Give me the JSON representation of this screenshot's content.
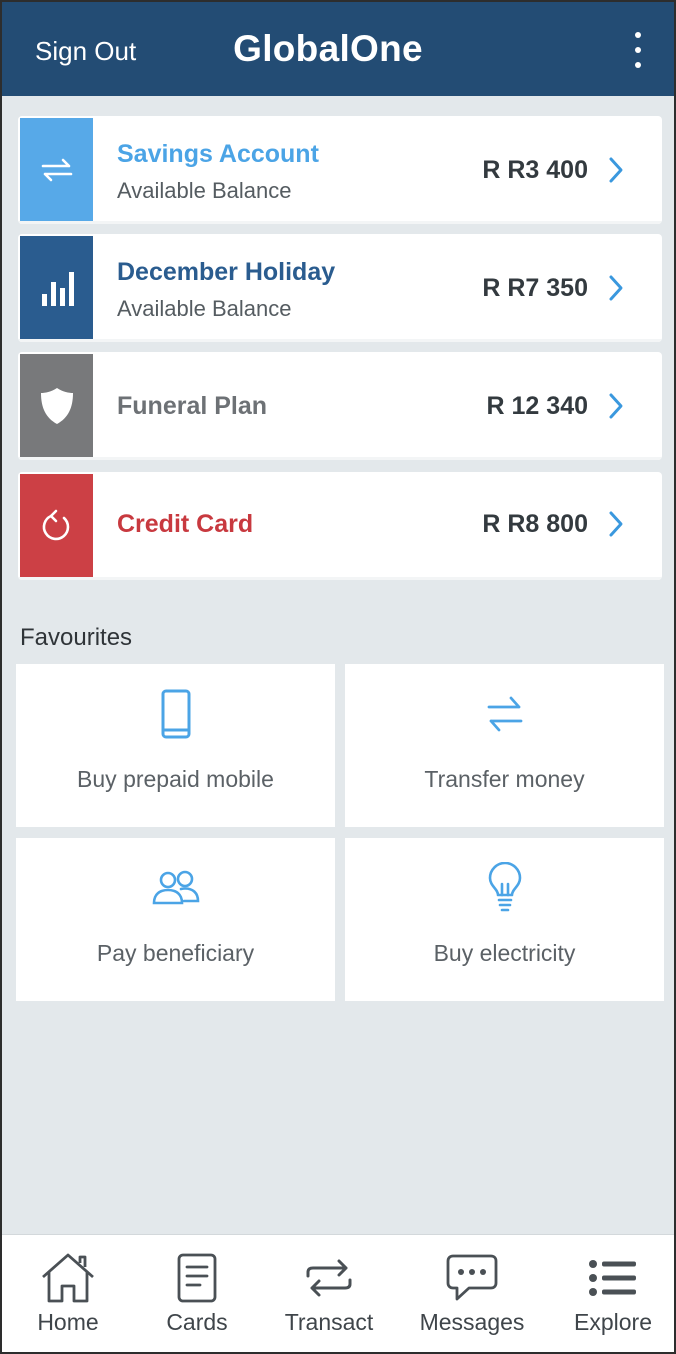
{
  "header": {
    "sign_out_label": "Sign Out",
    "title": "GlobalOne",
    "menu_icon": "more-vertical-icon",
    "background_color": "#234c74"
  },
  "accounts": [
    {
      "name": "Savings Account",
      "subtitle": "Available Balance",
      "amount": "R R3 400",
      "icon": "transfer-icon",
      "color": "#57a9e8",
      "name_color": "#4ba4e6"
    },
    {
      "name": "December Holiday",
      "subtitle": "Available Balance",
      "amount": "R R7 350",
      "icon": "bar-chart-icon",
      "color": "#2a5c8f",
      "name_color": "#2a5c8f"
    },
    {
      "name": "Funeral Plan",
      "subtitle": "",
      "amount": "R 12 340",
      "icon": "shield-icon",
      "color": "#78797b",
      "name_color": "#6d7175"
    },
    {
      "name": "Credit Card",
      "subtitle": "",
      "amount": "R R8 800",
      "icon": "refresh-icon",
      "color": "#cc4045",
      "name_color": "#c8393f"
    }
  ],
  "favourites": {
    "title": "Favourites",
    "items": [
      {
        "label": "Buy prepaid mobile",
        "icon": "mobile-phone-icon"
      },
      {
        "label": "Transfer money",
        "icon": "transfer-icon"
      },
      {
        "label": "Pay beneficiary",
        "icon": "users-icon"
      },
      {
        "label": "Buy electricity",
        "icon": "lightbulb-icon"
      }
    ]
  },
  "bottom_nav": [
    {
      "label": "Home",
      "icon": "home-icon"
    },
    {
      "label": "Cards",
      "icon": "card-document-icon"
    },
    {
      "label": "Transact",
      "icon": "transfer-icon"
    },
    {
      "label": "Messages",
      "icon": "chat-bubble-icon"
    },
    {
      "label": "Explore",
      "icon": "list-icon"
    }
  ],
  "colors": {
    "accent": "#4ba4e6",
    "page_background": "#e3e8eb"
  }
}
